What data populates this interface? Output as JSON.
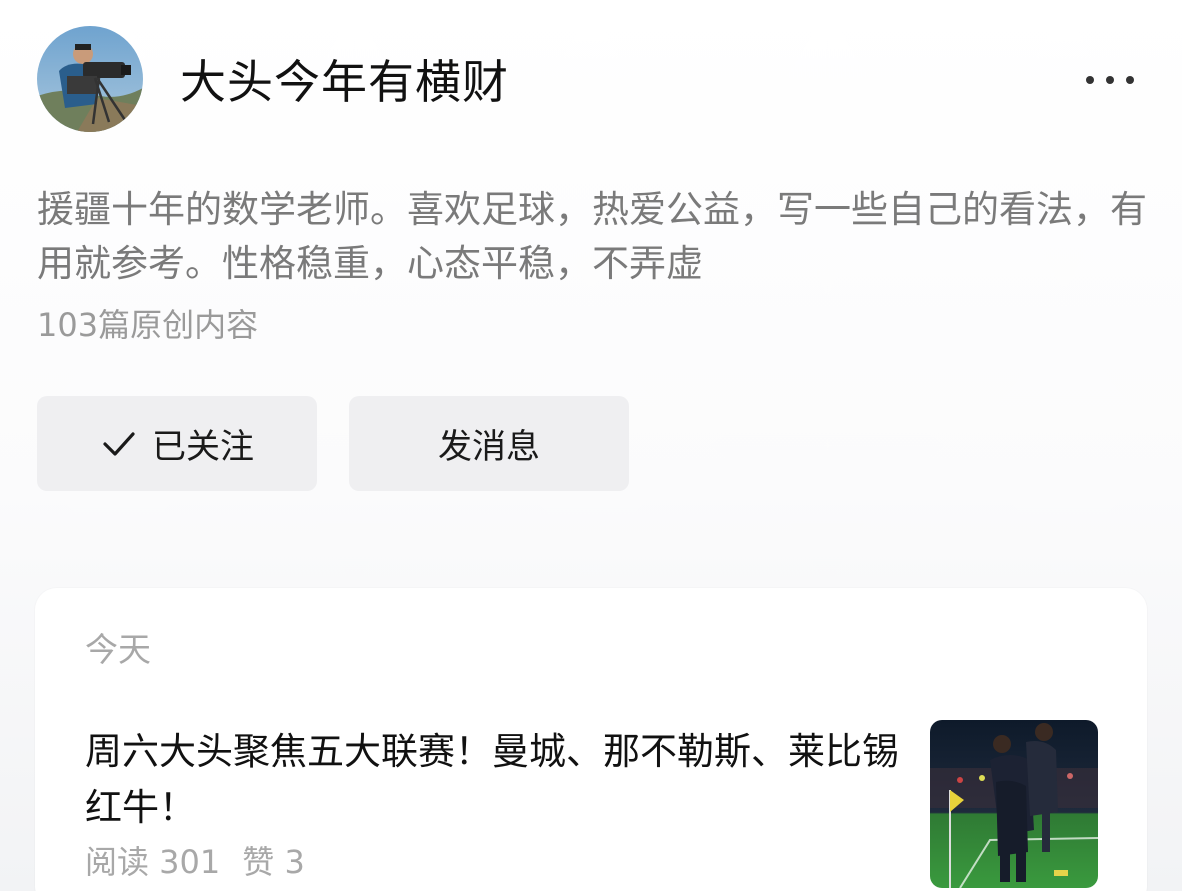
{
  "profile": {
    "name": "大头今年有横财",
    "bio": "援疆十年的数学老师。喜欢足球，热爱公益，写一些自己的看法，有用就参考。性格稳重，心态平稳，不弄虚",
    "original_count": "103篇原创内容"
  },
  "actions": {
    "follow_label": "已关注",
    "message_label": "发消息"
  },
  "feed": {
    "date": "今天",
    "article": {
      "title": "周六大头聚焦五大联赛！曼城、那不勒斯、莱比锡红牛！",
      "reads": "阅读 301",
      "likes": "赞 3"
    }
  },
  "icons": {
    "more": "more-dots-icon",
    "check": "check-icon"
  },
  "colors": {
    "button_bg": "#efeff1",
    "secondary_text": "#7a7a7a",
    "muted_text": "#a8a8a8"
  }
}
